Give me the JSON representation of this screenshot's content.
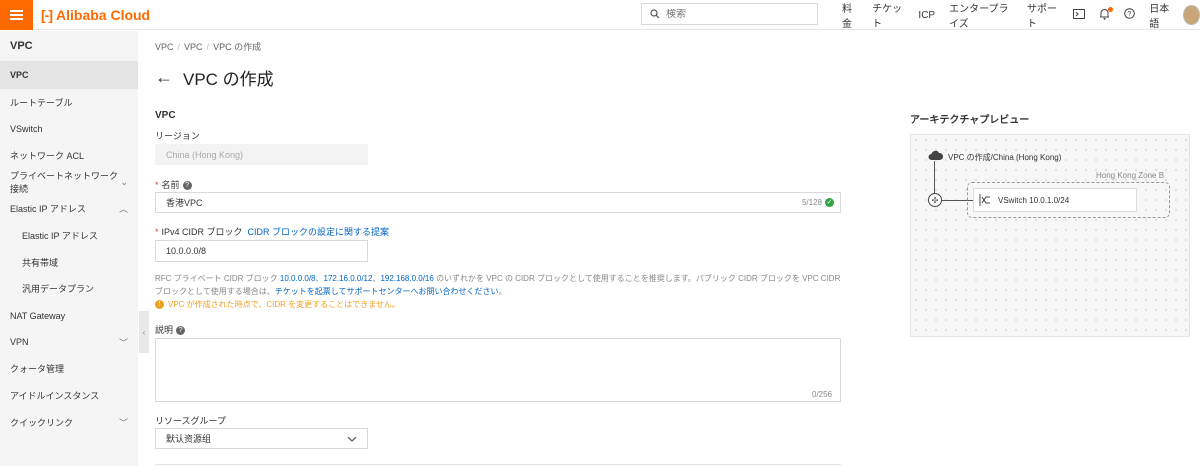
{
  "header": {
    "logo_mark": "[-]",
    "logo_text": "Alibaba Cloud",
    "search_placeholder": "検索",
    "nav": [
      "料金",
      "チケット",
      "ICP",
      "エンタープライズ",
      "サポート"
    ],
    "language": "日本語"
  },
  "sidebar": {
    "title": "VPC",
    "items": [
      {
        "label": "VPC"
      },
      {
        "label": "ルートテーブル"
      },
      {
        "label": "VSwitch"
      },
      {
        "label": "ネットワーク ACL"
      },
      {
        "label": "プライベートネットワーク接続"
      },
      {
        "label": "Elastic IP アドレス"
      },
      {
        "label": "Elastic IP アドレス"
      },
      {
        "label": "共有帯域"
      },
      {
        "label": "汎用データプラン"
      },
      {
        "label": "NAT Gateway"
      },
      {
        "label": "VPN"
      },
      {
        "label": "クォータ管理"
      },
      {
        "label": "アイドルインスタンス"
      },
      {
        "label": "クイックリンク"
      }
    ]
  },
  "breadcrumb": [
    "VPC",
    "VPC",
    "VPC の作成"
  ],
  "page_title": "VPC の作成",
  "form": {
    "section_title": "VPC",
    "region_label": "リージョン",
    "region_value": "China (Hong Kong)",
    "name_label": "名前",
    "name_value": "香港VPC",
    "name_counter": "5/128",
    "cidr_label": "IPv4 CIDR ブロック",
    "cidr_link": "CIDR ブロックの設定に関する提案",
    "cidr_value": "10.0.0.0/8",
    "hint_pre": "RFC プライベート CIDR ブロック",
    "hint_cidr1": "10.0.0.0/8",
    "hint_cidr2": "172.16.0.0/12",
    "hint_cidr3": "192.168.0.0/16",
    "hint_mid": "のいずれかを VPC の CIDR ブロックとして使用することを推奨します。パブリック CIDR ブロックを VPC CIDR ブロックとして使用する場合は、",
    "hint_link": "チケットを起票してサポートセンターへお問い合わせください",
    "hint_end": "。",
    "warning": "VPC が作成された時点で、CIDR を変更することはできません。",
    "desc_label": "説明",
    "desc_counter": "0/256",
    "rg_label": "リソースグループ",
    "rg_value": "默认资源组"
  },
  "preview": {
    "title": "アーキテクチャプレビュー",
    "vpc_label": "VPC の作成/China (Hong Kong)",
    "zone_label": "Hong Kong Zone B",
    "vswitch_label": "VSwitch 10.0.1.0/24"
  },
  "colors": {
    "brand": "#ff6a00",
    "link": "#0064c8",
    "warning": "#f0a020",
    "success": "#2fa53e"
  }
}
